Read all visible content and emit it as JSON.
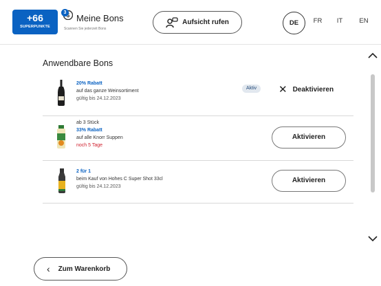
{
  "header": {
    "points_value": "+66",
    "points_label": "SUPERPUNKTE",
    "bons_count": "3",
    "title": "Meine Bons",
    "subtitle": "Scannen Sie jederzeit Bons",
    "call_button_label": "Aufsicht rufen",
    "languages": [
      "DE",
      "FR",
      "IT",
      "EN"
    ],
    "active_language": "DE"
  },
  "section_title": "Anwendbare Bons",
  "bons": [
    {
      "lines": [
        {
          "text": "20% Rabatt",
          "style": "blue"
        },
        {
          "text": "auf das ganze Weinsortiment",
          "style": "normal"
        },
        {
          "text": "gültig bis 24.12.2023",
          "style": "grey"
        }
      ],
      "status": "Aktiv",
      "action_label": "Deaktivieren",
      "image_icon": "wine-bottle-icon"
    },
    {
      "lines": [
        {
          "text": "ab 3 Stück",
          "style": "normal"
        },
        {
          "text": "33% Rabatt",
          "style": "blue"
        },
        {
          "text": "auf alle Knorr Suppen",
          "style": "normal"
        },
        {
          "text": "noch 5 Tage",
          "style": "red"
        }
      ],
      "action_label": "Aktivieren",
      "image_icon": "soup-bottle-icon"
    },
    {
      "lines": [
        {
          "text": "2 für 1",
          "style": "blue"
        },
        {
          "text": "beim Kauf von Hohes C Super Shot 33cl",
          "style": "normal"
        },
        {
          "text": "gültig bis 24.12.2023",
          "style": "grey"
        }
      ],
      "action_label": "Aktivieren",
      "image_icon": "juice-bottle-icon"
    }
  ],
  "footer": {
    "back_button_label": "Zum Warenkorb"
  },
  "colors": {
    "accent_blue": "#0a62c2",
    "warning_red": "#d0202e",
    "badge_bg": "#e2e8ef"
  }
}
